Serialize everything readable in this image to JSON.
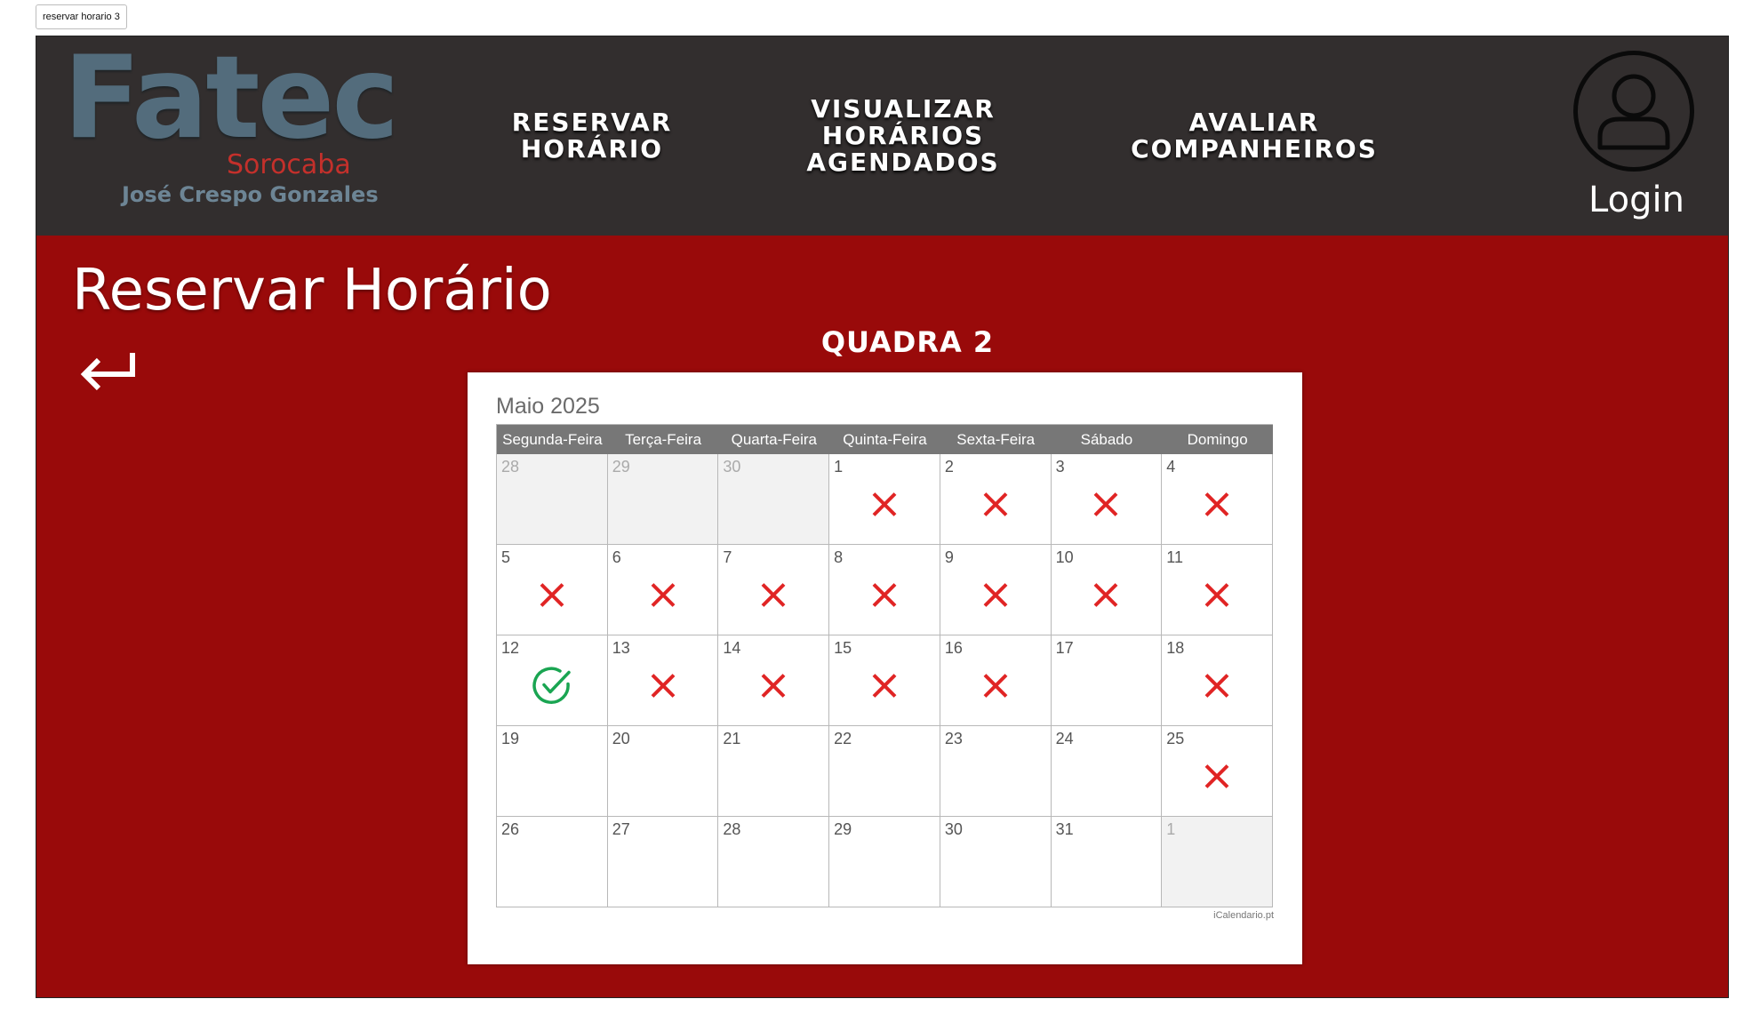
{
  "tab": {
    "label": "reservar horario 3"
  },
  "header": {
    "logo": {
      "brand": "Fatec",
      "city": "Sorocaba",
      "name": "José Crespo Gonzales"
    },
    "nav": [
      {
        "label": "RESERVAR\nHORÁRIO"
      },
      {
        "label": "VISUALIZAR\nHORÁRIOS\nAGENDADOS"
      },
      {
        "label": "AVALIAR\nCOMPANHEIROS"
      }
    ],
    "login": {
      "label": "Login",
      "icon": "user-icon"
    }
  },
  "main": {
    "title": "Reservar Horário",
    "back_icon": "return-arrow-icon",
    "court": "QUADRA 2"
  },
  "calendar": {
    "month": "Maio 2025",
    "weekdays": [
      "Segunda-Feira",
      "Terça-Feira",
      "Quarta-Feira",
      "Quinta-Feira",
      "Sexta-Feira",
      "Sábado",
      "Domingo"
    ],
    "cells": [
      {
        "day": "28",
        "outside": true,
        "status": ""
      },
      {
        "day": "29",
        "outside": true,
        "status": ""
      },
      {
        "day": "30",
        "outside": true,
        "status": ""
      },
      {
        "day": "1",
        "status": "unavailable"
      },
      {
        "day": "2",
        "status": "unavailable"
      },
      {
        "day": "3",
        "status": "unavailable"
      },
      {
        "day": "4",
        "status": "unavailable"
      },
      {
        "day": "5",
        "status": "unavailable"
      },
      {
        "day": "6",
        "status": "unavailable"
      },
      {
        "day": "7",
        "status": "unavailable"
      },
      {
        "day": "8",
        "status": "unavailable"
      },
      {
        "day": "9",
        "status": "unavailable"
      },
      {
        "day": "10",
        "status": "unavailable"
      },
      {
        "day": "11",
        "status": "unavailable"
      },
      {
        "day": "12",
        "status": "selected"
      },
      {
        "day": "13",
        "status": "unavailable"
      },
      {
        "day": "14",
        "status": "unavailable"
      },
      {
        "day": "15",
        "status": "unavailable"
      },
      {
        "day": "16",
        "status": "unavailable"
      },
      {
        "day": "17",
        "status": ""
      },
      {
        "day": "18",
        "status": "unavailable"
      },
      {
        "day": "19",
        "status": ""
      },
      {
        "day": "20",
        "status": ""
      },
      {
        "day": "21",
        "status": ""
      },
      {
        "day": "22",
        "status": ""
      },
      {
        "day": "23",
        "status": ""
      },
      {
        "day": "24",
        "status": ""
      },
      {
        "day": "25",
        "status": "unavailable"
      },
      {
        "day": "26",
        "status": ""
      },
      {
        "day": "27",
        "status": ""
      },
      {
        "day": "28",
        "status": ""
      },
      {
        "day": "29",
        "status": ""
      },
      {
        "day": "30",
        "status": ""
      },
      {
        "day": "31",
        "status": ""
      },
      {
        "day": "1",
        "outside": true,
        "status": ""
      }
    ],
    "credit": "iCalendario.pt"
  },
  "colors": {
    "header_bg": "#322e2e",
    "main_bg": "#990a0a",
    "unavailable_mark": "#e02424",
    "selected_mark": "#1aa552"
  }
}
